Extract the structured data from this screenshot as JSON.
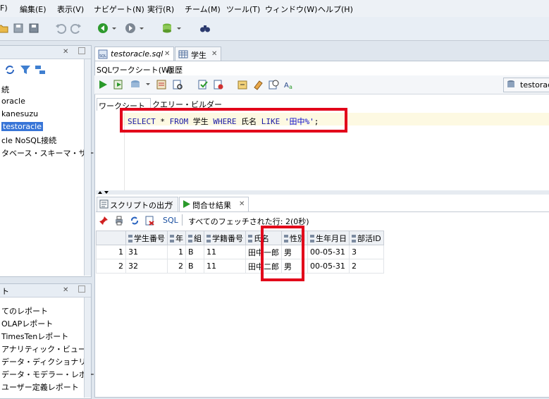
{
  "menu": [
    {
      "label": "F)"
    },
    {
      "label": "編集(E)"
    },
    {
      "label": "表示(V)"
    },
    {
      "label": "ナビゲート(N)"
    },
    {
      "label": "実行(R)"
    },
    {
      "label": "チーム(M)"
    },
    {
      "label": "ツール(T)"
    },
    {
      "label": "ウィンドウ(W)"
    },
    {
      "label": "ヘルプ(H)"
    }
  ],
  "tree": {
    "items": [
      "続",
      "oracle",
      "kanesuzu",
      "testoracle",
      "cle NoSQL接続",
      "タベース・スキーマ・サービス接"
    ]
  },
  "reports": {
    "header": "ト",
    "items": [
      "てのレポート",
      "OLAPレポート",
      "TimesTenレポート",
      "アナリティック・ビュー・レポ",
      "データ・ディクショナリ・レポ",
      "データ・モデラー・レポート",
      "ユーザー定義レポート"
    ]
  },
  "editor_tabs": [
    {
      "label": "testoracle.sql"
    },
    {
      "label": "学生"
    }
  ],
  "worksheet_tabs": {
    "sql": "SQLワークシート(W)",
    "history": "履歴"
  },
  "connection_label": "testorac",
  "builder_tabs": {
    "worksheet": "ワークシート",
    "query_builder": "クエリー・ビルダー"
  },
  "sql": {
    "kw1": "SELECT",
    "star": "*",
    "kw2": "FROM",
    "table": "学生",
    "kw3": "WHERE",
    "col": "氏名",
    "kw4": "LIKE",
    "str": "'田中%'",
    "end": ";"
  },
  "result_tabs": {
    "script": "スクリプトの出力",
    "query": "問合せ結果"
  },
  "result_toolbar": {
    "sql": "SQL",
    "status": "すべてのフェッチされた行: 2(0秒)"
  },
  "grid": {
    "headers": [
      "学生番号",
      "年",
      "組",
      "学籍番号",
      "氏名",
      "性別",
      "生年月日",
      "部活ID"
    ],
    "rows": [
      {
        "n": "1",
        "v": [
          "31",
          "1",
          "B",
          "11",
          "田中一郎",
          "男",
          "00-05-31",
          "3"
        ]
      },
      {
        "n": "2",
        "v": [
          "32",
          "2",
          "B",
          "11",
          "田中二郎",
          "男",
          "00-05-31",
          "2"
        ]
      }
    ]
  },
  "colors": {
    "highlight": "#e2001a",
    "selection": "#3875d7",
    "keyword": "#1a1aa6"
  }
}
